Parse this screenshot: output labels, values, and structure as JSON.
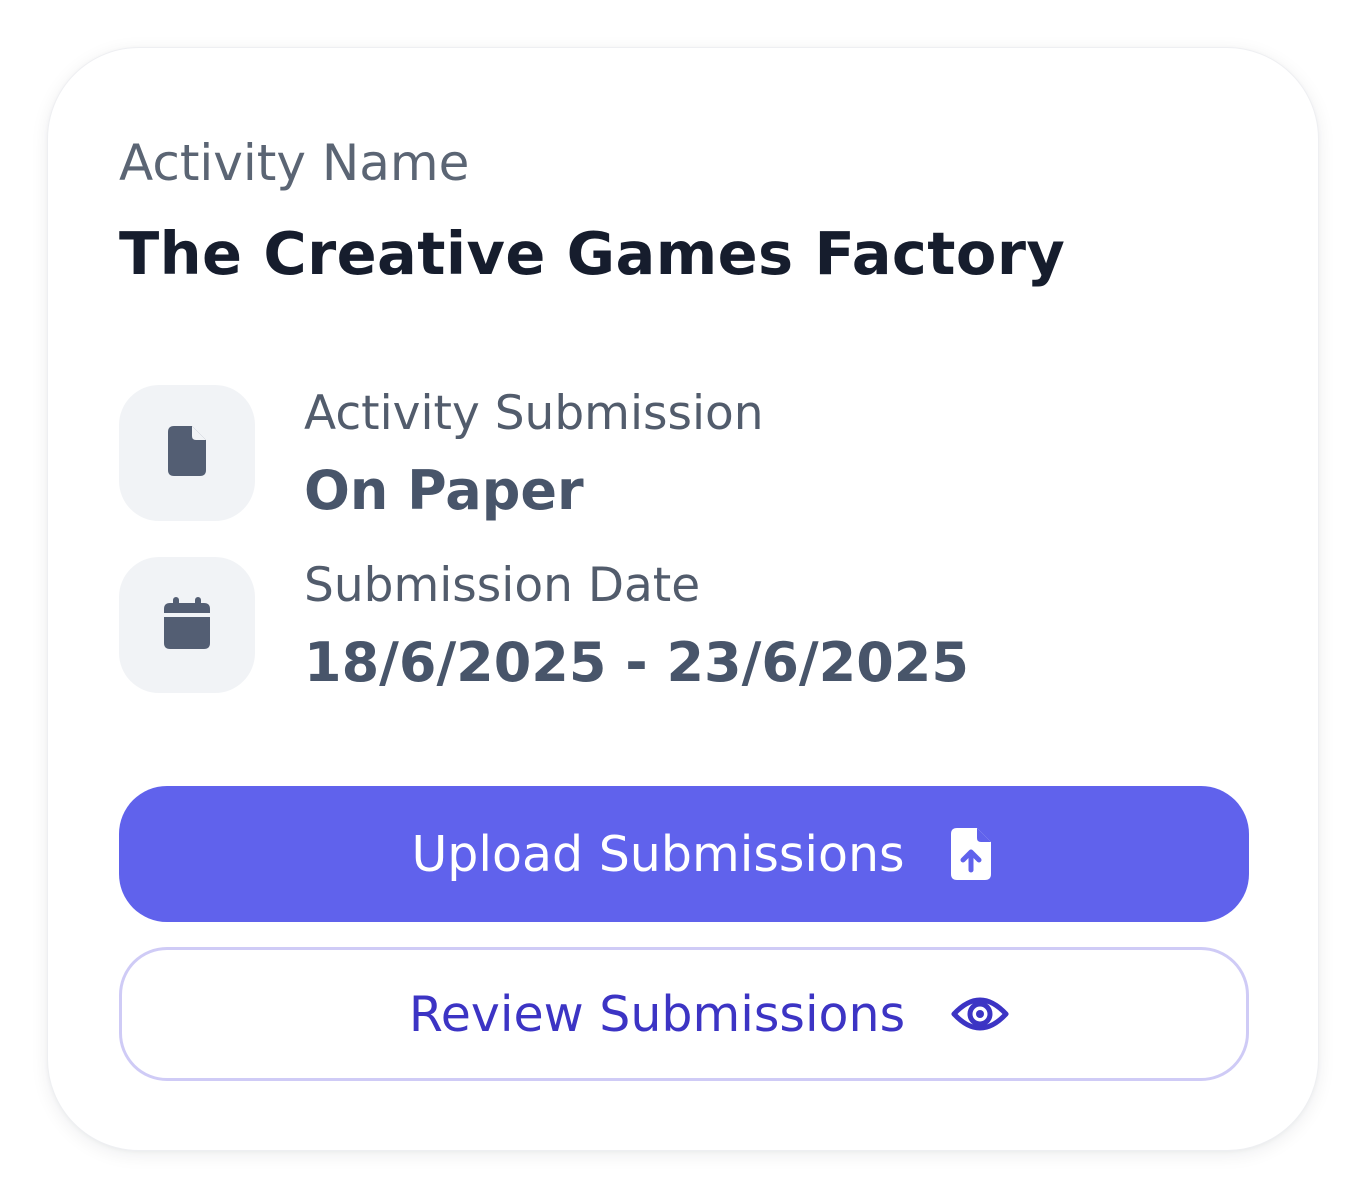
{
  "card": {
    "activity_label": "Activity Name",
    "activity_name": "The Creative Games Factory"
  },
  "submission": {
    "icon": "file-icon",
    "label": "Activity Submission",
    "value": "On Paper"
  },
  "date": {
    "icon": "calendar-icon",
    "label": "Submission Date",
    "value": "18/6/2025 - 23/6/2025"
  },
  "buttons": {
    "upload_label": "Upload Submissions",
    "upload_icon": "file-upload-icon",
    "review_label": "Review Submissions",
    "review_icon": "eye-icon"
  },
  "colors": {
    "primary": "#6062ec",
    "review_text": "#3c34c4",
    "review_border": "#cfcbf6",
    "icon_gray": "#535e73"
  }
}
